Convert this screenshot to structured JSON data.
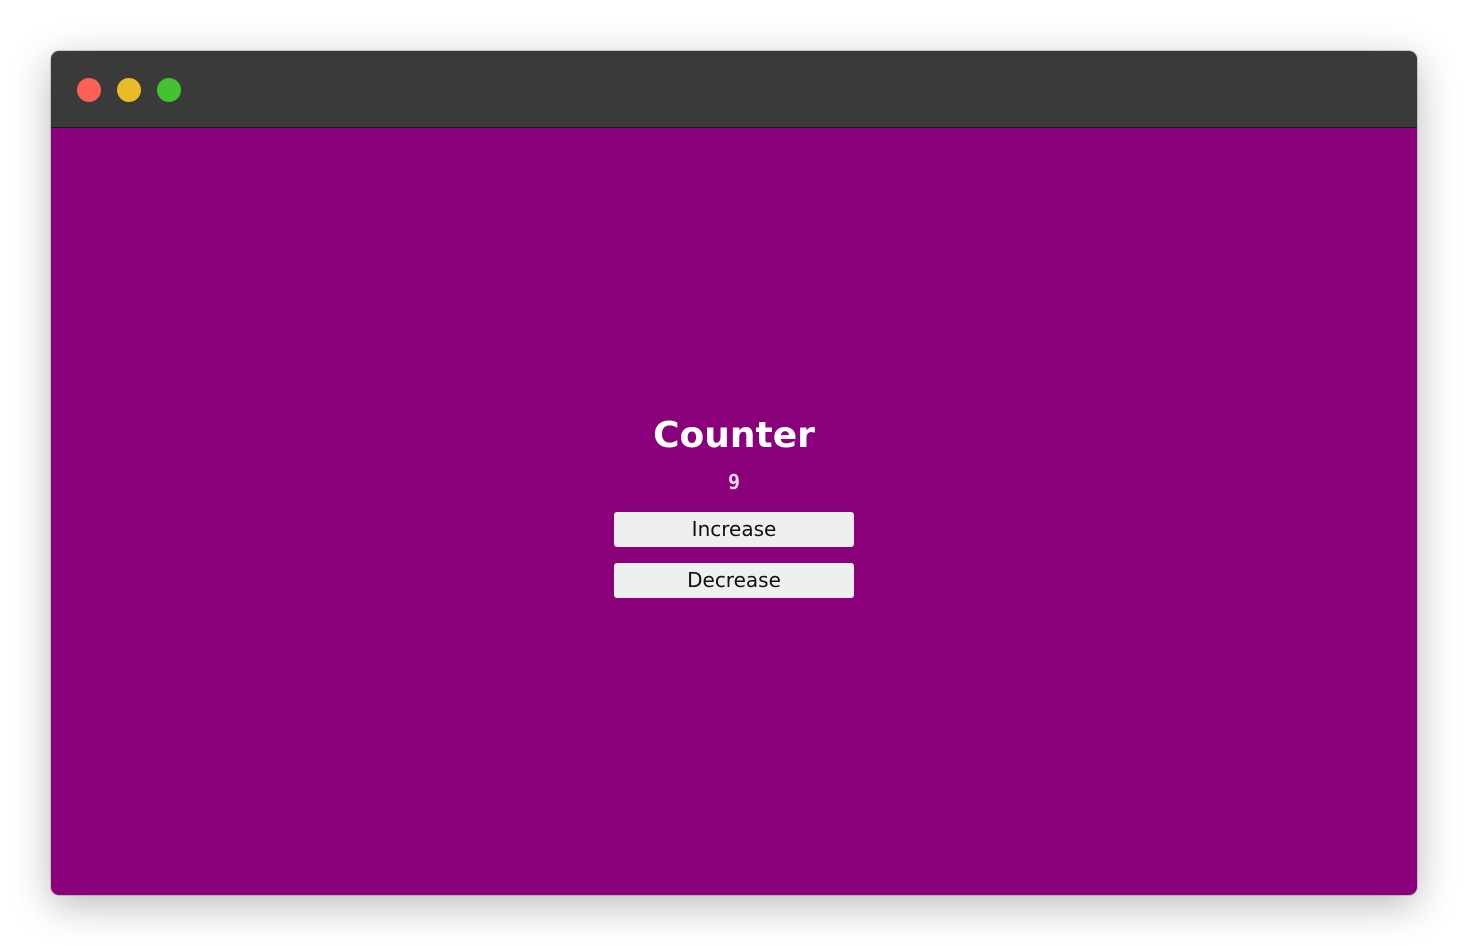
{
  "window": {
    "controls": {
      "close_icon": "close-icon",
      "minimize_icon": "minimize-icon",
      "maximize_icon": "maximize-icon"
    },
    "colors": {
      "titlebar": "#3a3a3a",
      "close": "#fe5f57",
      "minimize": "#e8bb28",
      "maximize": "#44c231",
      "content_background": "#8b007b"
    }
  },
  "app": {
    "title": "Counter",
    "count": "9",
    "increase_label": "Increase",
    "decrease_label": "Decrease"
  }
}
